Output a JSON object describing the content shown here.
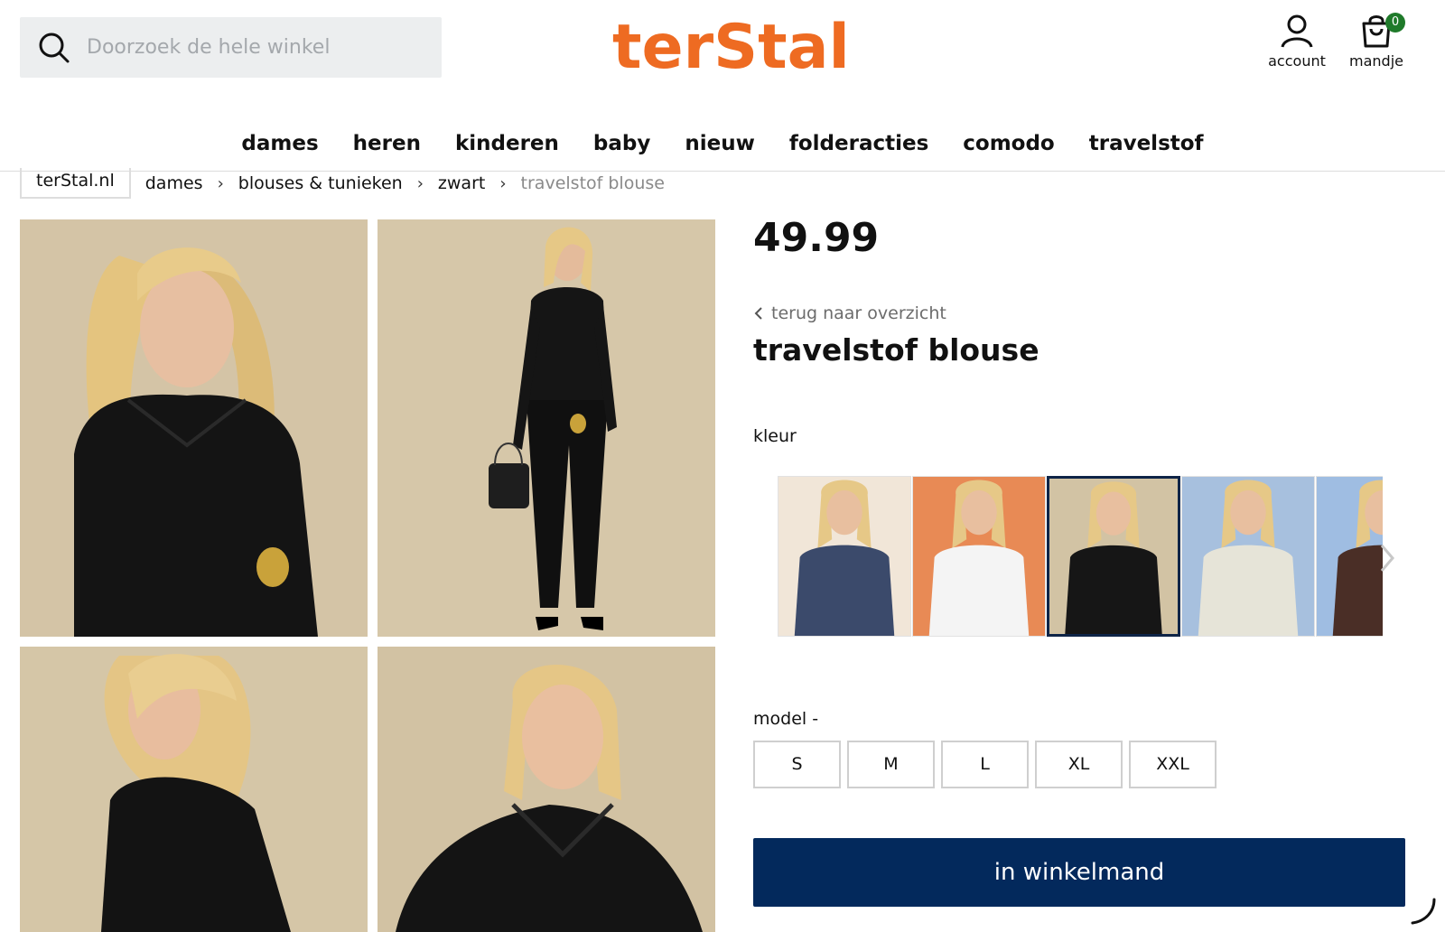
{
  "search": {
    "placeholder": "Doorzoek de hele winkel"
  },
  "brand": {
    "logo_text": "terStal",
    "color": "#ee6b22"
  },
  "header": {
    "account_label": "account",
    "cart_label": "mandje",
    "cart_count": "0"
  },
  "nav": {
    "items": [
      {
        "label": "dames"
      },
      {
        "label": "heren"
      },
      {
        "label": "kinderen"
      },
      {
        "label": "baby"
      },
      {
        "label": "nieuw"
      },
      {
        "label": "folderacties"
      },
      {
        "label": "comodo"
      },
      {
        "label": "travelstof"
      }
    ]
  },
  "breadcrumb": {
    "home": "terStal.nl",
    "items": [
      "dames",
      "blouses & tunieken",
      "zwart",
      "travelstof blouse"
    ]
  },
  "product": {
    "price": "49.99",
    "back_label": "terug naar overzicht",
    "title": "travelstof blouse",
    "color_label": "kleur",
    "model_label": "model -",
    "sizes": [
      "S",
      "M",
      "L",
      "XL",
      "XXL"
    ],
    "add_to_cart": "in winkelmand",
    "colors": [
      {
        "icon": "navy-blouse-swatch",
        "bg": "#f1e6d8",
        "garment": "#3b4a6b"
      },
      {
        "icon": "white-blouse-swatch",
        "bg": "#e88a55",
        "garment": "#f4f4f4"
      },
      {
        "icon": "black-blouse-swatch",
        "bg": "#d2c3a4",
        "garment": "#161616",
        "selected": true
      },
      {
        "icon": "cream-blouse-swatch",
        "bg": "#a7c0de",
        "garment": "#e6e4d8"
      },
      {
        "icon": "brown-blouse-swatch",
        "bg": "#9fbde2",
        "garment": "#4a2e26"
      }
    ]
  },
  "colors": {
    "button": "#03295c",
    "badge": "#1f7a2a"
  }
}
